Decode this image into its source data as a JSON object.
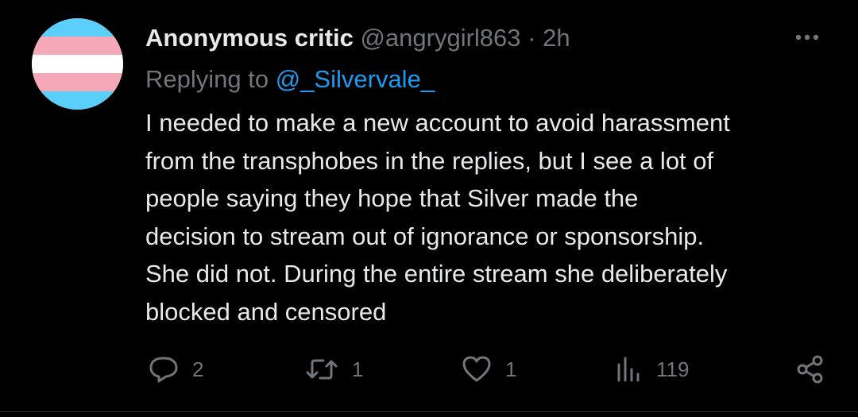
{
  "tweet": {
    "display_name": "Anonymous critic",
    "handle": "@angrygirl863",
    "separator": "·",
    "time": "2h",
    "replying_to_label": "Replying to",
    "replying_to_handle": "@_Silvervale_",
    "text_lines": [
      "I needed to make a new account to avoid harassment",
      "from the transphobes in the replies, but I see a lot of",
      "people saying they hope that Silver made the",
      "decision to stream out of ignorance or sponsorship.",
      "She did not. During the entire stream she deliberately",
      "blocked and censored"
    ],
    "avatar": "transgender-flag",
    "actions": {
      "replies": "2",
      "retweets": "1",
      "likes": "1",
      "views": "119"
    }
  },
  "icons": {
    "more": "more-horizontal-icon",
    "reply": "reply-bubble-icon",
    "retweet": "retweet-icon",
    "like": "heart-icon",
    "views": "views-bar-chart-icon",
    "share": "share-icon"
  },
  "colors": {
    "background": "#000000",
    "text_primary": "#e7e9ea",
    "text_secondary": "#71767b",
    "accent_link": "#1d9bf0",
    "flag_blue": "#5bcefa",
    "flag_pink": "#f5a9b8",
    "flag_white": "#ffffff"
  }
}
